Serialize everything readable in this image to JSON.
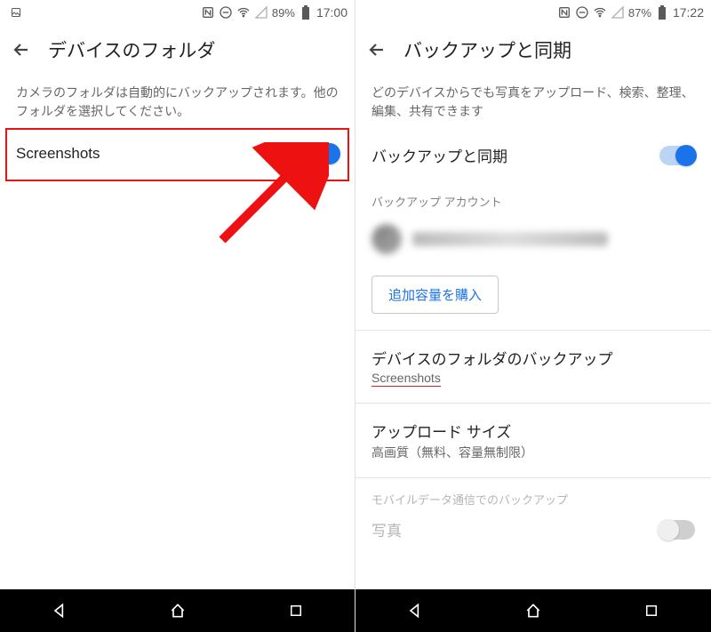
{
  "left": {
    "statusbar": {
      "battery": "89%",
      "time": "17:00"
    },
    "title": "デバイスのフォルダ",
    "desc": "カメラのフォルダは自動的にバックアップされます。他のフォルダを選択してください。",
    "folder_row": {
      "label": "Screenshots",
      "on": true
    }
  },
  "right": {
    "statusbar": {
      "battery": "87%",
      "time": "17:22"
    },
    "title": "バックアップと同期",
    "desc": "どのデバイスからでも写真をアップロード、検索、整理、編集、共有できます",
    "backup_sync": {
      "label": "バックアップと同期",
      "on": true
    },
    "account_header": "バックアップ アカウント",
    "buy_button": "追加容量を購入",
    "device_folders": {
      "title": "デバイスのフォルダのバックアップ",
      "value": "Screenshots"
    },
    "upload_size": {
      "title": "アップロード サイズ",
      "value": "高画質（無料、容量無制限）"
    },
    "mobile_data_header": "モバイルデータ通信でのバックアップ",
    "photos_label": "写真"
  },
  "icons": {
    "nfc": "NFC",
    "dnd": "DND",
    "wifi": "Wi-Fi",
    "signal": "Signal",
    "battery": "Battery",
    "photo": "Photo"
  }
}
